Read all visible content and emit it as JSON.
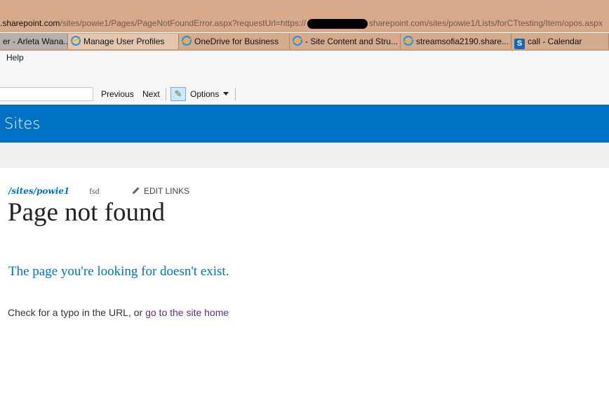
{
  "address_bar": {
    "host": ".sharepoint.com",
    "path_part1": "/sites/powie1/Pages/PageNotFoundError.aspx?requestUrl=https://",
    "path_part2": "sharepoint.com/sites/powie1/Lists/forCTtesting/Item/opos.aspx"
  },
  "tabs": [
    {
      "label": "er - Arleta Wana...",
      "icon": "none"
    },
    {
      "label": "Manage User Profiles",
      "icon": "ie-icon"
    },
    {
      "label": "OneDrive for Business",
      "icon": "ie-icon"
    },
    {
      "label": "- Site Content and Stru...",
      "icon": "ie-icon"
    },
    {
      "label": "streamsofia2190.share...",
      "icon": "ie-icon"
    },
    {
      "label": "call - Calendar",
      "icon": "sharepoint-icon"
    }
  ],
  "menu": {
    "help": "Help"
  },
  "find_bar": {
    "previous": "Previous",
    "next": "Next",
    "options": "Options"
  },
  "suite_bar": {
    "title": "Sites"
  },
  "content": {
    "breadcrumb": "/sites/powie1",
    "nav_item": "fsd",
    "edit_links": "EDIT LINKS",
    "page_title": "Page not found",
    "subtitle": "The page you're looking for doesn't exist.",
    "message_prefix": "Check for a typo in the URL, or ",
    "home_link": "go to the site home"
  },
  "colors": {
    "suite_bar": "#0072c6",
    "link": "#0072c6",
    "visited_link": "#5c2d91"
  }
}
